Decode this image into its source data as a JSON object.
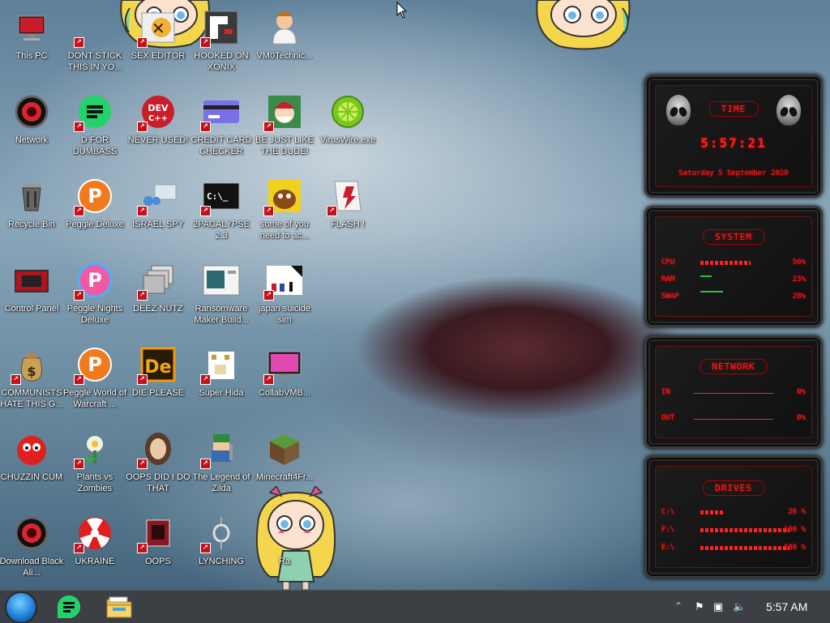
{
  "desktop": {
    "icons": [
      {
        "label": "This PC",
        "name": "this-pc"
      },
      {
        "label": "DONT STICK THIS IN YO...",
        "name": "dont-stick"
      },
      {
        "label": "SEX EDITOR",
        "name": "sex-editor"
      },
      {
        "label": "HOOKED ON XONIX",
        "name": "hooked-on-xonix"
      },
      {
        "label": "VM0Technic...",
        "name": "vm0technic"
      },
      {
        "label": "Network",
        "name": "network"
      },
      {
        "label": "D FOR DUMBASS",
        "name": "d-for-dumbass"
      },
      {
        "label": "NEVER USED!",
        "name": "never-used"
      },
      {
        "label": "CREDIT CARD CHECKER",
        "name": "credit-card-checker"
      },
      {
        "label": "BE JUST LIKE THE DUDE!",
        "name": "be-just-like-the-dude"
      },
      {
        "label": "VirusWire.exe",
        "name": "viruswire"
      },
      {
        "label": "Recycle Bin",
        "name": "recycle-bin"
      },
      {
        "label": "Peggle Deluxe",
        "name": "peggle-deluxe"
      },
      {
        "label": "ISRAEL SPY",
        "name": "israel-spy"
      },
      {
        "label": "2PACALYPSE 2.3",
        "name": "2pacalypse"
      },
      {
        "label": "some of you need to ac...",
        "name": "some-of-you"
      },
      {
        "label": "FLASH !",
        "name": "flash"
      },
      {
        "label": "Control Panel",
        "name": "control-panel"
      },
      {
        "label": "Peggle Nights Deluxe",
        "name": "peggle-nights"
      },
      {
        "label": "DEEZ NUTZ",
        "name": "deez-nutz"
      },
      {
        "label": "Ransomware Maker Build...",
        "name": "ransomware-maker"
      },
      {
        "label": "japan suicide sim",
        "name": "japan-suicide-sim"
      },
      {
        "label": "COMMUNISTS HATE THIS G...",
        "name": "communists"
      },
      {
        "label": "Peggle World of Warcraft ...",
        "name": "peggle-wow"
      },
      {
        "label": "DIE PLEASE",
        "name": "die-please"
      },
      {
        "label": "Super Hida",
        "name": "super-hida"
      },
      {
        "label": "CollabVMB...",
        "name": "collabvm"
      },
      {
        "label": "CHUZZIN CUM",
        "name": "chuzzin"
      },
      {
        "label": "Plants vs Zombies",
        "name": "plants-vs-zombies"
      },
      {
        "label": "OOPS DID I DO THAT",
        "name": "oops-did-i"
      },
      {
        "label": "The Legend of Zilda",
        "name": "legend-of-zilda"
      },
      {
        "label": "Minecraft4Fr...",
        "name": "minecraft"
      },
      {
        "label": "Download Black Ali...",
        "name": "download-black-ali"
      },
      {
        "label": "UKRAINE",
        "name": "ukraine"
      },
      {
        "label": "OOPS",
        "name": "oops"
      },
      {
        "label": "LYNCHING",
        "name": "lynching"
      },
      {
        "label": "Ra",
        "name": "ra-partial"
      }
    ]
  },
  "widget": {
    "time": {
      "title": "TIME",
      "clock": "5:57:21",
      "date": "Saturday 5 September 2020"
    },
    "system": {
      "title": "SYSTEM",
      "rows": [
        {
          "key": "CPU",
          "value": "56%",
          "level": 0.56
        },
        {
          "key": "RAM",
          "value": "23%",
          "level": 0.23
        },
        {
          "key": "SWAP",
          "value": "28%",
          "level": 0.28
        }
      ]
    },
    "network": {
      "title": "NETWORK",
      "rows": [
        {
          "key": "IN",
          "value": "0%"
        },
        {
          "key": "OUT",
          "value": "0%"
        }
      ]
    },
    "drives": {
      "title": "DRIVES",
      "rows": [
        {
          "key": "C:\\",
          "value": "26 %",
          "level": 0.26
        },
        {
          "key": "F:\\",
          "value": "100 %",
          "level": 1.0
        },
        {
          "key": "E:\\",
          "value": "100 %",
          "level": 1.0
        }
      ]
    }
  },
  "taskbar": {
    "clock": "5:57 AM",
    "tray_icons": [
      "chevron-up-icon",
      "flag-icon",
      "network-icon",
      "volume-icon"
    ]
  },
  "colors": {
    "accent_red": "#ff2020",
    "taskbar": "#3c3f44"
  }
}
